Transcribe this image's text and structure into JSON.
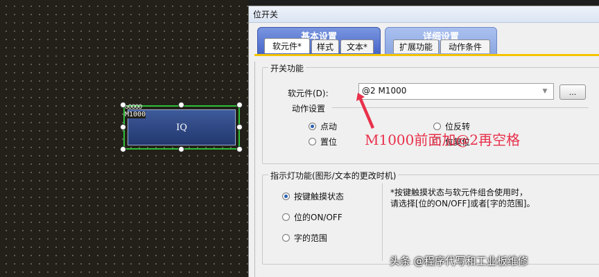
{
  "canvas": {
    "object": {
      "tag_line1": "oOOOO",
      "tag_line2": "M1000",
      "label": "IQ"
    }
  },
  "dialog": {
    "title": "位开关",
    "group_tabs": {
      "basic": "基本设置",
      "detail": "详细设置"
    },
    "sub_tabs": [
      "软元件*",
      "样式",
      "文本*",
      "扩展功能",
      "动作条件"
    ],
    "switch_group": {
      "title": "开关功能",
      "device_label": "软元件(D):",
      "device_value": "@2 M1000",
      "browse_label": "...",
      "action_title": "动作设置",
      "options": [
        {
          "label": "点动",
          "selected": true
        },
        {
          "label": "位反转",
          "selected": false
        },
        {
          "label": "置位",
          "selected": false
        },
        {
          "label": "位复位",
          "selected": false
        }
      ]
    },
    "indicator_group": {
      "title": "指示灯功能(图形/文本的更改时机)",
      "options": [
        {
          "label": "按键触摸状态",
          "selected": true
        },
        {
          "label": "位的ON/OFF",
          "selected": false
        },
        {
          "label": "字的范围",
          "selected": false
        }
      ],
      "note_line1": "*按键触摸状态与软元件组合使用时，",
      "note_line2": "请选择[位的ON/OFF]或者[字的范围]。"
    }
  },
  "annotation": {
    "text": "M1000前面加@2再空格",
    "color": "#e8304a"
  },
  "watermark": {
    "text": "头条 @程序代写和工业板维修"
  }
}
